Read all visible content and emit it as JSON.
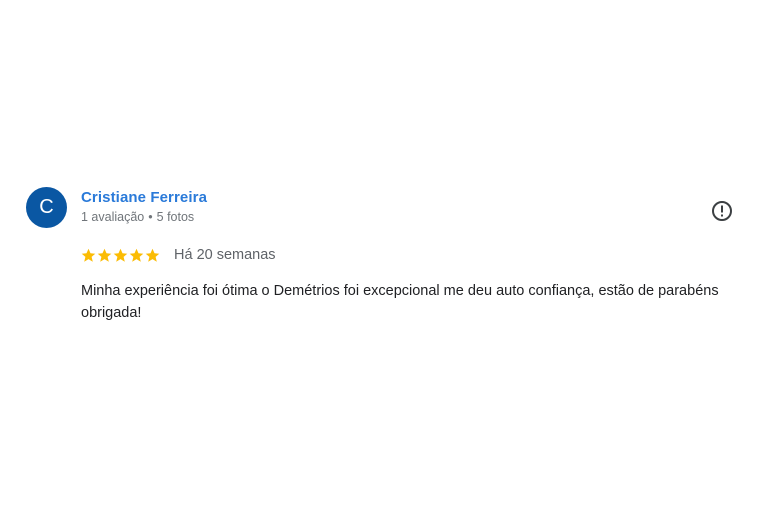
{
  "review": {
    "author": {
      "initial": "C",
      "name": "Cristiane Ferreira",
      "review_count": "1 avaliação",
      "separator": "•",
      "photo_count": "5 fotos",
      "avatar_color": "#0a57a3",
      "name_color": "#2a7ad9"
    },
    "rating": 5,
    "rating_max": 5,
    "star_color": "#fbbc04",
    "date": "Há 20 semanas",
    "text": "Minha experiência foi ótima o Demétrios foi excepcional me deu auto confiança, estão de parabéns obrigada!",
    "report_icon": "alert-circle-icon"
  }
}
